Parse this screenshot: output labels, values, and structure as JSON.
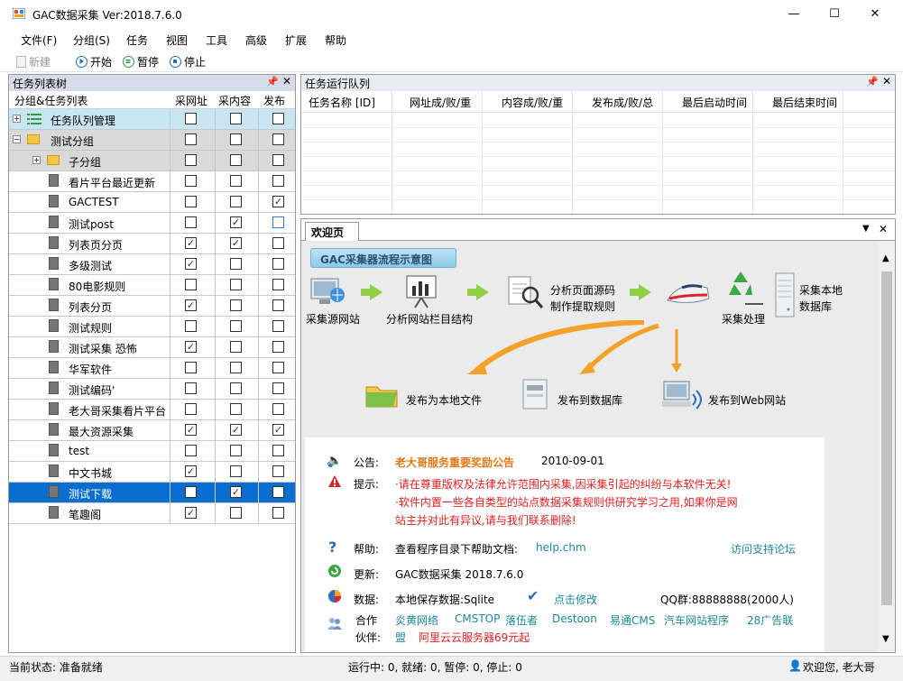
{
  "window": {
    "title": "GAC数据采集 Ver:2018.7.6.0",
    "minimize": "—",
    "maximize": "☐",
    "close": "✕"
  },
  "menu": [
    "文件(F)",
    "分组(S)",
    "任务",
    "视图",
    "工具",
    "高级",
    "扩展",
    "帮助"
  ],
  "toolbar": {
    "new": "新建",
    "start": "开始",
    "pause": "暂停",
    "stop": "停止"
  },
  "left_panel": {
    "title": "任务列表树",
    "columns": [
      "分组&任务列表",
      "采网址",
      "采内容",
      "发布"
    ],
    "rows": [
      {
        "label": "任务队列管理",
        "type": "queue",
        "c": [
          false,
          false,
          false
        ]
      },
      {
        "label": "测试分组",
        "type": "group",
        "c": [
          false,
          false,
          false
        ]
      },
      {
        "label": "子分组",
        "type": "subgroup",
        "c": [
          false,
          false,
          false
        ]
      },
      {
        "label": "看片平台最近更新",
        "type": "task",
        "c": [
          false,
          false,
          false
        ]
      },
      {
        "label": "GACTEST",
        "type": "task",
        "c": [
          false,
          false,
          true
        ]
      },
      {
        "label": "测试post",
        "type": "task",
        "c": [
          false,
          true,
          false
        ]
      },
      {
        "label": "列表页分页",
        "type": "task",
        "c": [
          true,
          true,
          false
        ]
      },
      {
        "label": "多级测试",
        "type": "task",
        "c": [
          true,
          false,
          false
        ]
      },
      {
        "label": "80电影规则",
        "type": "task",
        "c": [
          false,
          false,
          false
        ]
      },
      {
        "label": "列表分页",
        "type": "task",
        "c": [
          true,
          false,
          false
        ]
      },
      {
        "label": "测试规则",
        "type": "task",
        "c": [
          false,
          false,
          false
        ]
      },
      {
        "label": "测试采集 恐怖",
        "type": "task",
        "c": [
          true,
          false,
          false
        ]
      },
      {
        "label": "华军软件",
        "type": "task",
        "c": [
          false,
          false,
          false
        ]
      },
      {
        "label": "测试编码'",
        "type": "task",
        "c": [
          false,
          false,
          false
        ]
      },
      {
        "label": "老大哥采集看片平台",
        "type": "task",
        "c": [
          false,
          false,
          false
        ]
      },
      {
        "label": "最大资源采集",
        "type": "task",
        "c": [
          true,
          true,
          true
        ]
      },
      {
        "label": "test",
        "type": "task",
        "c": [
          false,
          false,
          false
        ]
      },
      {
        "label": "中文书城",
        "type": "task",
        "c": [
          true,
          false,
          false
        ]
      },
      {
        "label": "测试下载",
        "type": "task",
        "c": [
          false,
          true,
          false
        ],
        "selected": true
      },
      {
        "label": "笔趣阁",
        "type": "task",
        "c": [
          true,
          false,
          false
        ]
      }
    ]
  },
  "queue_panel": {
    "title": "任务运行队列",
    "columns": [
      "任务名称 [ID]",
      "网址成/败/重",
      "内容成/败/重",
      "发布成/败/总",
      "最后启动时间",
      "最后结束时间"
    ]
  },
  "welcome": {
    "tab": "欢迎页",
    "flow_title": "GAC采集器流程示意图",
    "steps": [
      "采集源网站",
      "分析网站栏目结构",
      "分析页面源码",
      "制作提取规则",
      "采集处理",
      "采集本地",
      "数据库"
    ],
    "outputs": [
      "发布为本地文件",
      "发布到数据库",
      "发布到Web网站"
    ],
    "notice": {
      "announce_label": "公告:",
      "announce_title": "老大哥服务重要奖励公告",
      "announce_date": "2010-09-01",
      "tip_label": "提示:",
      "tip1": "·请在尊重版权及法律允许范围内采集,因采集引起的纠纷与本软件无关!",
      "tip2": "·软件内置一些各自类型的站点数据采集规则供研究学习之用,如果你是网",
      "tip3": "站主并对此有异议,请与我们联系删除!",
      "help_label": "帮助:",
      "help_text": "查看程序目录下帮助文档:",
      "help_link": "help.chm",
      "forum_link": "访问支持论坛",
      "update_label": "更新:",
      "update_text": "GAC数据采集 2018.7.6.0",
      "data_label": "数据:",
      "data_text": "本地保存数据:Sqlite",
      "data_link": "点击修改",
      "qq": "QQ群:88888888(2000人)",
      "partner_label1": "合作",
      "partner_label2": "伙伴:",
      "partners": [
        "炎黄网络",
        "CMSTOP",
        "落伍者",
        "Destoon",
        "易通CMS",
        "汽车网站程序",
        "28广告联"
      ],
      "partners_line2_a": "盟",
      "partners_line2_b": "阿里云云服务器69元起"
    }
  },
  "status": {
    "current": "当前状态:  准备就绪",
    "counts": "运行中: 0, 就绪: 0, 暂停: 0, 停止: 0",
    "welcome": "欢迎您, 老大哥"
  },
  "colors": {
    "selected_row": "#0a6ed1",
    "accent_green": "#8fcf43",
    "orange": "#e07a1a",
    "red": "#e02020"
  }
}
